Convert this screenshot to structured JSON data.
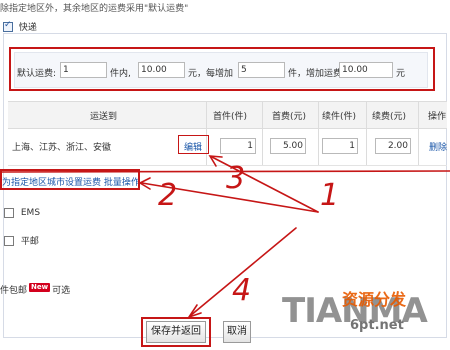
{
  "top_note": "除指定地区外，其余地区的运费采用\"默认运费\"",
  "express": {
    "label": "快递",
    "checked": true
  },
  "defaults": {
    "label_default": "默认运费:",
    "first_qty": "1",
    "unit_pieces_within": "件内,",
    "first_fee": "10.00",
    "unit_yuan_each": "元，每增加",
    "add_qty": "5",
    "unit_pieces_add": "件，增加运费",
    "add_fee": "10.00",
    "unit_yuan": "元"
  },
  "table": {
    "headers": [
      "运送到",
      "首件(件)",
      "首费(元)",
      "续件(件)",
      "续费(元)",
      "操作"
    ],
    "rows": [
      {
        "region": "上海、江苏、浙江、安徽",
        "edit": "编辑",
        "first_qty": "1",
        "first_fee": "5.00",
        "add_qty": "1",
        "add_fee": "2.00",
        "action": "删除"
      }
    ]
  },
  "batch_link": "为指定地区城市设置运费 批量操作",
  "ems": {
    "label": "EMS",
    "checked": false
  },
  "post": {
    "label": "平邮",
    "checked": false
  },
  "freeship": {
    "prefix": "件包邮",
    "badge": "New",
    "suffix": "可选"
  },
  "buttons": {
    "save": "保存并返回",
    "cancel": "取消"
  },
  "annotations": [
    "1",
    "2",
    "3",
    "4"
  ],
  "watermark": {
    "latin": "TIANMA",
    "cn": "资源分发",
    "url": "6pt.net"
  },
  "colors": {
    "annotation_red": "#c61616",
    "link_blue": "#1a56a8",
    "new_badge": "#d3001d"
  }
}
